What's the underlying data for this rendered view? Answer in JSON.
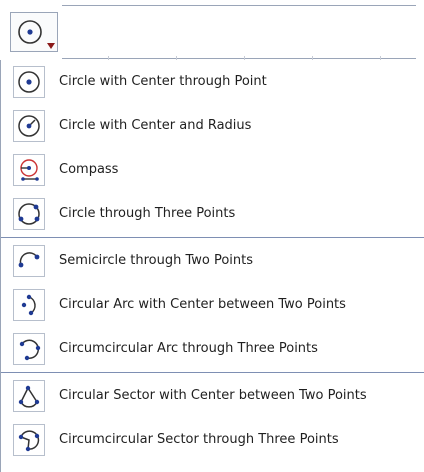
{
  "toolbar": {
    "selected_tool_icon": "circle-center-point-icon"
  },
  "menu": {
    "groups": [
      {
        "items": [
          {
            "label": "Circle with Center through Point",
            "icon": "circle-center-point-icon"
          },
          {
            "label": "Circle with Center and Radius",
            "icon": "circle-center-radius-icon"
          },
          {
            "label": "Compass",
            "icon": "compass-icon"
          },
          {
            "label": "Circle through Three Points",
            "icon": "circle-three-points-icon"
          }
        ]
      },
      {
        "items": [
          {
            "label": "Semicircle through Two Points",
            "icon": "semicircle-icon"
          },
          {
            "label": "Circular Arc with Center between Two Points",
            "icon": "circular-arc-icon"
          },
          {
            "label": "Circumcircular Arc through Three Points",
            "icon": "circumcircular-arc-icon"
          }
        ]
      },
      {
        "items": [
          {
            "label": "Circular Sector with Center between Two Points",
            "icon": "circular-sector-icon"
          },
          {
            "label": "Circumcircular Sector through Three Points",
            "icon": "circumcircular-sector-icon"
          }
        ]
      }
    ]
  },
  "colors": {
    "point": "#1f3a93",
    "stroke": "#333333",
    "compass": "#cc3333",
    "separator": "#7e8fb3"
  }
}
